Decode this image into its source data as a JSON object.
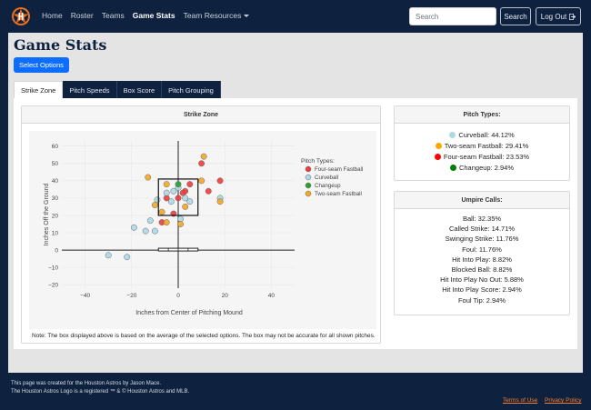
{
  "nav": {
    "links": [
      "Home",
      "Roster",
      "Teams",
      "Game Stats",
      "Team Resources"
    ],
    "search_placeholder": "Search",
    "search_button": "Search",
    "logout_button": "Log Out"
  },
  "page": {
    "title": "Game Stats",
    "select_button": "Select Options",
    "tabs": [
      "Strike Zone",
      "Pitch Speeds",
      "Box Score",
      "Pitch Grouping"
    ]
  },
  "strike_zone": {
    "header": "Strike Zone",
    "note": "Note: The box displayed above is based on the average of the selected options. The box may not be accurate for all shown pitches."
  },
  "pitch_types": {
    "header": "Pitch Types:",
    "items": [
      {
        "label": "Curveball: 44.12%",
        "color": "#add8e6"
      },
      {
        "label": "Two-seam Fastball: 29.41%",
        "color": "#ffa500"
      },
      {
        "label": "Four-seam Fastball: 23.53%",
        "color": "#ff0000"
      },
      {
        "label": "Changeup: 2.94%",
        "color": "#008000"
      }
    ]
  },
  "umpire_calls": {
    "header": "Umpire Calls:",
    "items": [
      "Ball: 32.35%",
      "Called Strike: 14.71%",
      "Swinging Strike: 11.76%",
      "Foul: 11.76%",
      "Hit Into Play: 8.82%",
      "Blocked Ball: 8.82%",
      "Hit Into Play No Out: 5.88%",
      "Hit Into Play Score: 2.94%",
      "Foul Tip: 2.94%"
    ]
  },
  "footer": {
    "line1": "This page was created for the Houston Astros by Jason Mace.",
    "line2": "The Houston Astros Logo is a registered ™ & © Houston Astros and MLB.",
    "terms": "Terms of Use",
    "privacy": "Privacy Policy"
  },
  "colors": {
    "navy": "#0e2240",
    "orange": "#eb6e1f",
    "primary": "#0d6efd"
  },
  "chart_data": {
    "type": "scatter",
    "title": "",
    "xlabel": "Inches from Center of Pitching Mound",
    "ylabel": "Inches Off the Ground",
    "xlim": [
      -50,
      50
    ],
    "ylim": [
      -22,
      63
    ],
    "xticks": [
      -40,
      -20,
      0,
      20,
      40
    ],
    "yticks": [
      -20,
      -10,
      0,
      10,
      20,
      30,
      40,
      50,
      60
    ],
    "legend_title": "Pitch Types:",
    "legend_position": "top-right",
    "strike_zone_box": {
      "x": [
        -8.5,
        8.5
      ],
      "y": [
        20,
        41
      ]
    },
    "series": [
      {
        "name": "Four-seam Fastball",
        "color": "#ef3b3b",
        "points": [
          [
            10,
            50
          ],
          [
            18,
            40
          ],
          [
            13,
            34
          ],
          [
            5,
            38
          ],
          [
            3,
            34
          ],
          [
            2,
            33
          ],
          [
            -5,
            30
          ],
          [
            -2,
            21
          ],
          [
            -7,
            16
          ],
          [
            0,
            30
          ]
        ]
      },
      {
        "name": "Curveball",
        "color": "#add8e6",
        "points": [
          [
            -30,
            -3
          ],
          [
            -22,
            -4
          ],
          [
            -19,
            13
          ],
          [
            -14,
            11
          ],
          [
            -10,
            11
          ],
          [
            -5,
            33
          ],
          [
            -2,
            34
          ],
          [
            0,
            36
          ],
          [
            -3,
            28
          ],
          [
            3,
            30
          ],
          [
            5,
            28
          ],
          [
            18,
            30
          ],
          [
            -9,
            29
          ],
          [
            -12,
            17
          ],
          [
            1,
            18
          ]
        ]
      },
      {
        "name": "Changeup",
        "color": "#2ca02c",
        "points": [
          [
            0,
            38
          ]
        ]
      },
      {
        "name": "Two-seam Fastball",
        "color": "#f5a623",
        "points": [
          [
            -13,
            42
          ],
          [
            11,
            54
          ],
          [
            -5,
            38
          ],
          [
            18,
            28
          ],
          [
            -7,
            22
          ],
          [
            -5,
            16
          ],
          [
            -10,
            26
          ],
          [
            1,
            15
          ],
          [
            10,
            40
          ],
          [
            3,
            25
          ]
        ]
      }
    ]
  }
}
